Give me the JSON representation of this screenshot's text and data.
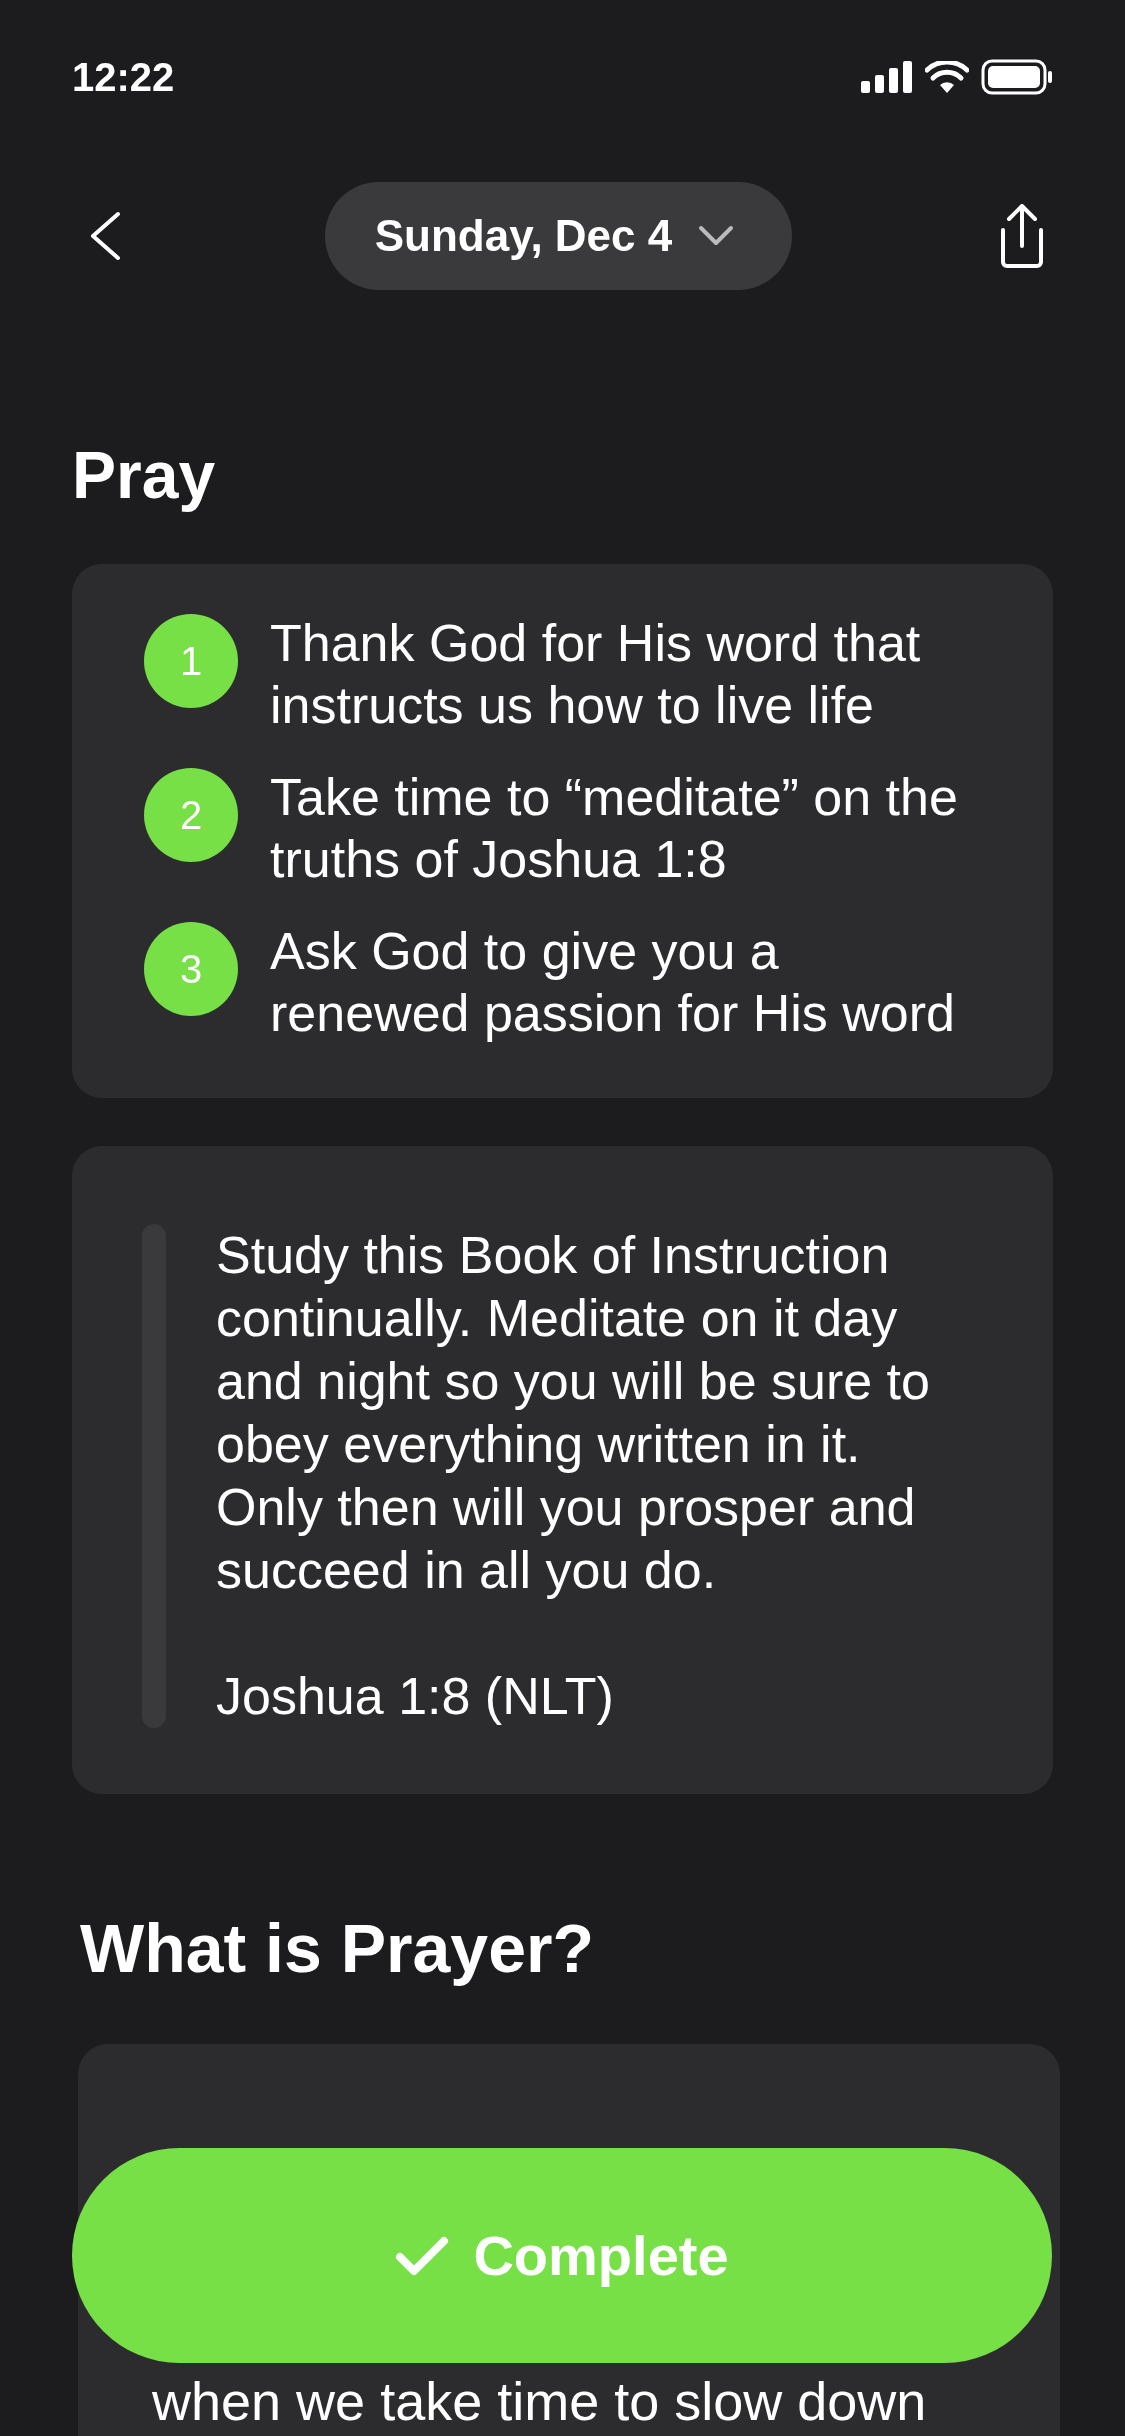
{
  "status_bar": {
    "time": "12:22"
  },
  "nav": {
    "date": "Sunday, Dec 4"
  },
  "title": "Pray",
  "steps": [
    {
      "number": "1",
      "text": "Thank God for His word that instructs us how to live life"
    },
    {
      "number": "2",
      "text": "Take time to “meditate” on the truths of Joshua 1:8"
    },
    {
      "number": "3",
      "text": "Ask God to give you a renewed passion for His word"
    }
  ],
  "quote": {
    "text": "Study this Book of Instruction continually. Meditate on it day and night so you will be sure to obey everything written in it. Only then will you prosper and succeed in all you do.",
    "reference": "Joshua 1:8 (NLT)"
  },
  "section": {
    "title": "What is Prayer?",
    "lines": [
      "when we take time to slow down"
    ]
  },
  "button": {
    "label": "Complete"
  }
}
